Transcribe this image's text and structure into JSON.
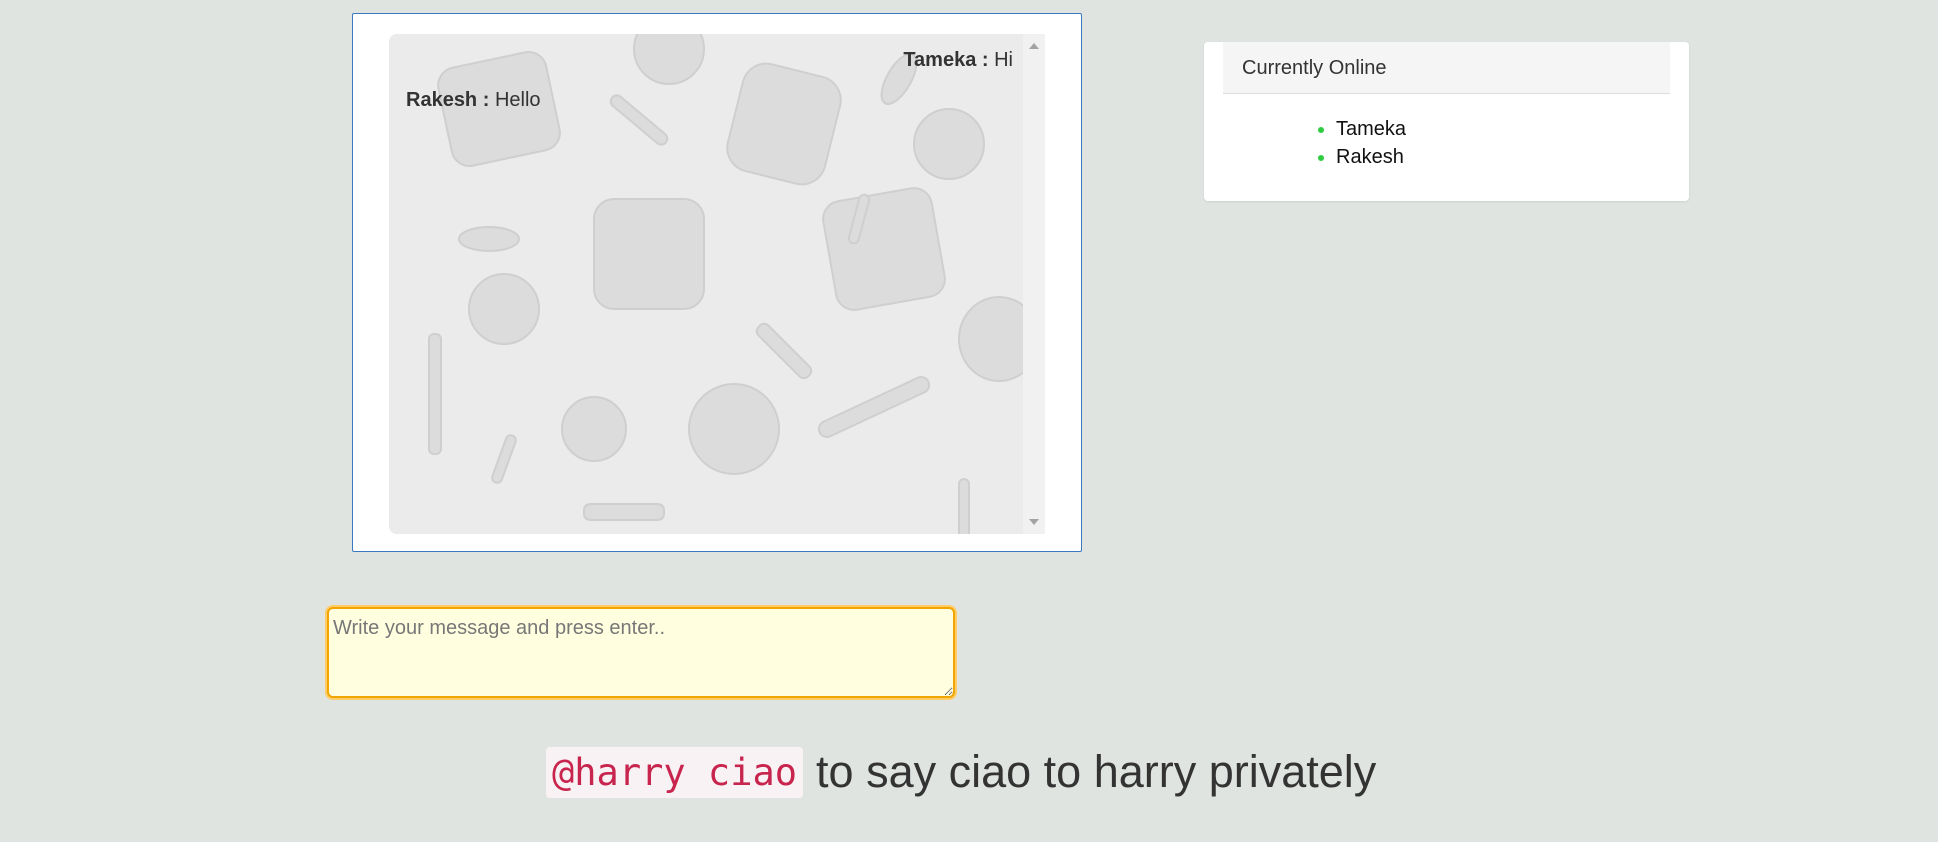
{
  "chat": {
    "messages": [
      {
        "user": "Tameka",
        "separator": " : ",
        "text": "Hi",
        "align": "right"
      },
      {
        "user": "Rakesh",
        "separator": " : ",
        "text": "Hello",
        "align": "left"
      }
    ]
  },
  "online": {
    "title": "Currently Online",
    "users": [
      "Tameka",
      "Rakesh"
    ],
    "status_color": "#2ecc40"
  },
  "input": {
    "placeholder": "Write your message and press enter..",
    "value": ""
  },
  "hint": {
    "code": "@harry ciao",
    "text": "to say ciao to harry privately"
  },
  "colors": {
    "page_background": "#e0e4e1",
    "panel_border": "#3a78c2",
    "input_background": "#ffffe0",
    "input_border": "#f0a500",
    "code_color": "#c7254e"
  }
}
